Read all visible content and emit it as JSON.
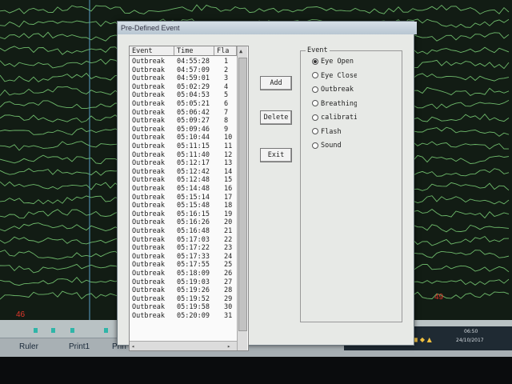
{
  "dialog": {
    "title": "Pre-Defined Event",
    "columns": [
      "Event",
      "Time",
      "Fla"
    ],
    "rows": [
      {
        "event": "Outbreak",
        "time": "04:55:28",
        "flag": "1"
      },
      {
        "event": "Outbreak",
        "time": "04:57:09",
        "flag": "2"
      },
      {
        "event": "Outbreak",
        "time": "04:59:01",
        "flag": "3"
      },
      {
        "event": "Outbreak",
        "time": "05:02:29",
        "flag": "4"
      },
      {
        "event": "Outbreak",
        "time": "05:04:53",
        "flag": "5"
      },
      {
        "event": "Outbreak",
        "time": "05:05:21",
        "flag": "6"
      },
      {
        "event": "Outbreak",
        "time": "05:06:42",
        "flag": "7"
      },
      {
        "event": "Outbreak",
        "time": "05:09:27",
        "flag": "8"
      },
      {
        "event": "Outbreak",
        "time": "05:09:46",
        "flag": "9"
      },
      {
        "event": "Outbreak",
        "time": "05:10:44",
        "flag": "10"
      },
      {
        "event": "Outbreak",
        "time": "05:11:15",
        "flag": "11"
      },
      {
        "event": "Outbreak",
        "time": "05:11:40",
        "flag": "12"
      },
      {
        "event": "Outbreak",
        "time": "05:12:17",
        "flag": "13"
      },
      {
        "event": "Outbreak",
        "time": "05:12:42",
        "flag": "14"
      },
      {
        "event": "Outbreak",
        "time": "05:12:48",
        "flag": "15"
      },
      {
        "event": "Outbreak",
        "time": "05:14:48",
        "flag": "16"
      },
      {
        "event": "Outbreak",
        "time": "05:15:14",
        "flag": "17"
      },
      {
        "event": "Outbreak",
        "time": "05:15:48",
        "flag": "18"
      },
      {
        "event": "Outbreak",
        "time": "05:16:15",
        "flag": "19"
      },
      {
        "event": "Outbreak",
        "time": "05:16:26",
        "flag": "20"
      },
      {
        "event": "Outbreak",
        "time": "05:16:48",
        "flag": "21"
      },
      {
        "event": "Outbreak",
        "time": "05:17:03",
        "flag": "22"
      },
      {
        "event": "Outbreak",
        "time": "05:17:22",
        "flag": "23"
      },
      {
        "event": "Outbreak",
        "time": "05:17:33",
        "flag": "24"
      },
      {
        "event": "Outbreak",
        "time": "05:17:55",
        "flag": "25"
      },
      {
        "event": "Outbreak",
        "time": "05:18:09",
        "flag": "26"
      },
      {
        "event": "Outbreak",
        "time": "05:19:03",
        "flag": "27"
      },
      {
        "event": "Outbreak",
        "time": "05:19:26",
        "flag": "28"
      },
      {
        "event": "Outbreak",
        "time": "05:19:52",
        "flag": "29"
      },
      {
        "event": "Outbreak",
        "time": "05:19:58",
        "flag": "30"
      },
      {
        "event": "Outbreak",
        "time": "05:20:09",
        "flag": "31"
      }
    ],
    "buttons": {
      "add": "Add",
      "delete": "Delete",
      "exit": "Exit"
    },
    "event_group": {
      "legend": "Event",
      "options": [
        "Eye Open",
        "Eye Close",
        "Outbreak",
        "Breathing",
        "calibration",
        "Flash",
        "Sound"
      ],
      "selected_index": 0
    }
  },
  "background": {
    "page_left": "46",
    "page_right": "49",
    "toolbar": [
      "Ruler",
      "Print1",
      "Prin"
    ],
    "trace_color": "#7fd67a"
  },
  "taskbar": {
    "lang": "EN",
    "time": "06:50",
    "date": "24/10/2017"
  }
}
